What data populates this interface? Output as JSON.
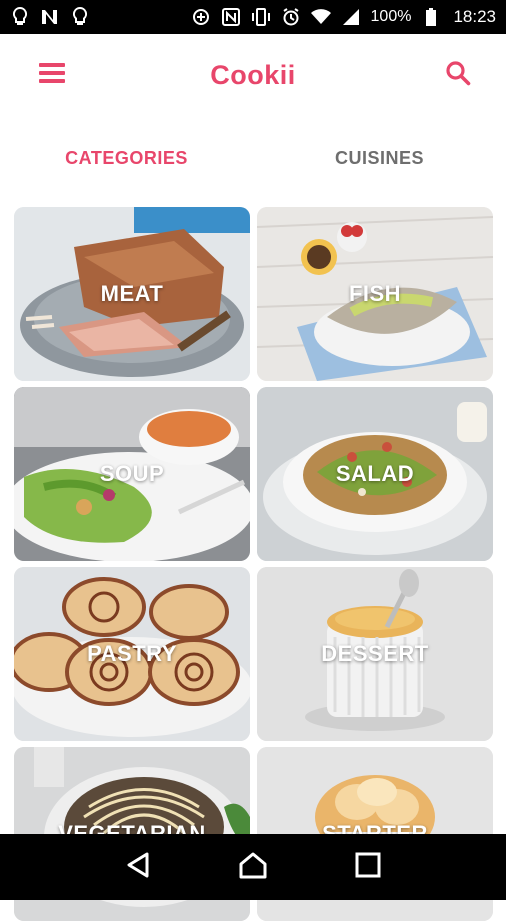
{
  "status_bar": {
    "left_icons": [
      "bulb-icon",
      "n-icon",
      "bulb-icon"
    ],
    "right_icons": [
      "data-saver-icon",
      "nfc-icon",
      "vibrate-icon",
      "alarm-icon",
      "wifi-icon",
      "signal-icon"
    ],
    "battery": "100%",
    "time": "18:23"
  },
  "app_bar": {
    "title": "Cookii",
    "menu_icon": "menu-icon",
    "search_icon": "search-icon",
    "accent": "#e8466b"
  },
  "tabs": [
    {
      "label": "CATEGORIES",
      "active": true
    },
    {
      "label": "CUISINES",
      "active": false
    }
  ],
  "categories": [
    {
      "label": "MEAT"
    },
    {
      "label": "FISH"
    },
    {
      "label": "SOUP"
    },
    {
      "label": "SALAD"
    },
    {
      "label": "PASTRY"
    },
    {
      "label": "DESSERT"
    },
    {
      "label": "VEGETARIAN"
    },
    {
      "label": "STARTER"
    }
  ],
  "nav_bar": {
    "back": "back-icon",
    "home": "home-icon",
    "recents": "recents-icon"
  }
}
